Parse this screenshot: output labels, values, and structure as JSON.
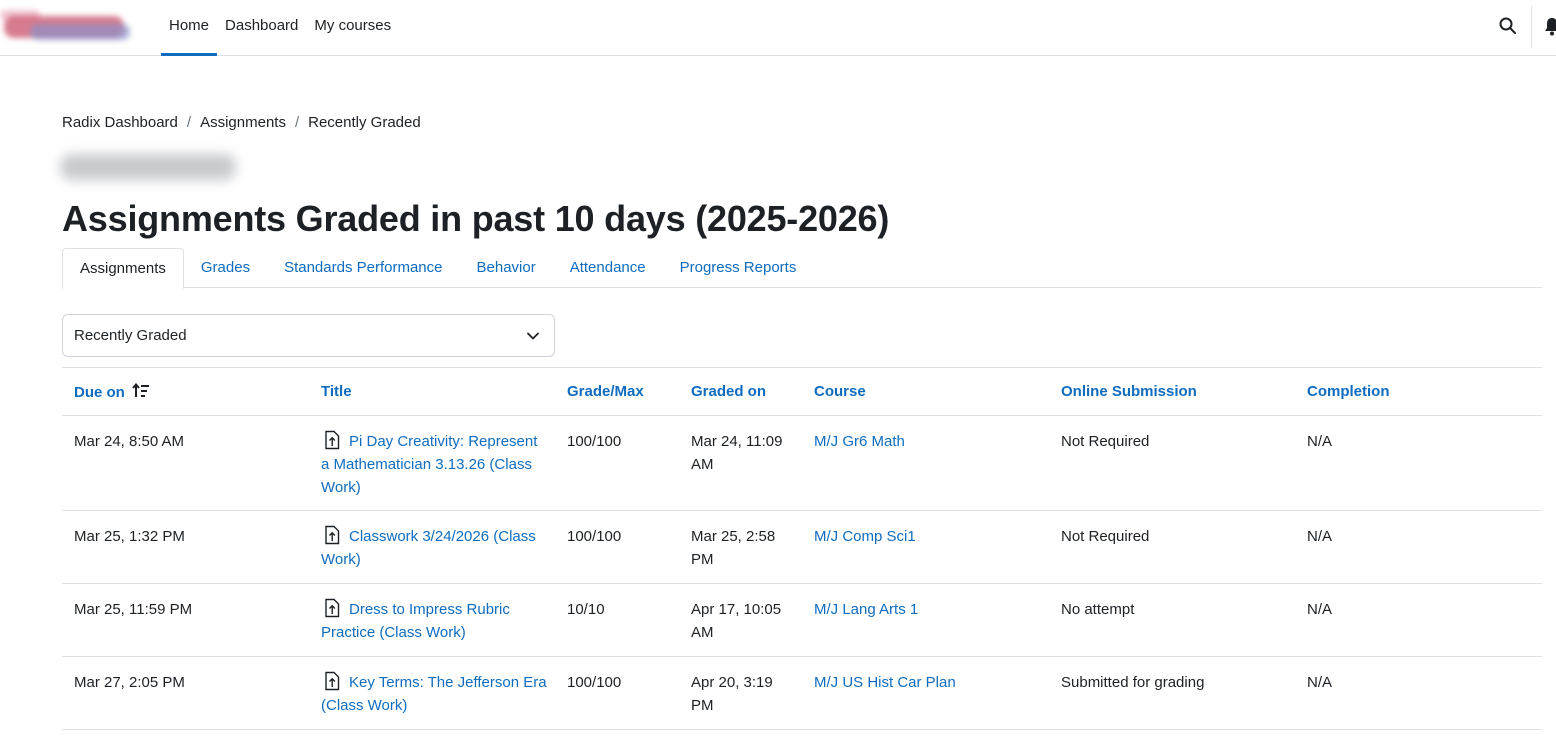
{
  "nav": {
    "links": [
      "Home",
      "Dashboard",
      "My courses"
    ]
  },
  "breadcrumb": [
    "Radix Dashboard",
    "Assignments",
    "Recently Graded"
  ],
  "page": {
    "title": "Assignments Graded in past 10 days (2025-2026)"
  },
  "tabs": [
    "Assignments",
    "Grades",
    "Standards Performance",
    "Behavior",
    "Attendance",
    "Progress Reports"
  ],
  "filter": {
    "selected": "Recently Graded"
  },
  "table": {
    "headers": {
      "due_on": "Due on",
      "title": "Title",
      "grade_max": "Grade/Max",
      "graded_on": "Graded on",
      "course": "Course",
      "online_submission": "Online Submission",
      "completion": "Completion"
    },
    "rows": [
      {
        "due_on": "Mar 24, 8:50 AM",
        "title": "Pi Day Creativity: Represent a Mathematician 3.13.26 (Class Work)",
        "grade_max": "100/100",
        "graded_on": "Mar 24, 11:09 AM",
        "course": "M/J Gr6 Math",
        "online_submission": "Not Required",
        "completion": "N/A"
      },
      {
        "due_on": "Mar 25, 1:32 PM",
        "title": "Classwork 3/24/2026 (Class Work)",
        "grade_max": "100/100",
        "graded_on": "Mar 25, 2:58 PM",
        "course": "M/J Comp Sci1",
        "online_submission": "Not Required",
        "completion": "N/A"
      },
      {
        "due_on": "Mar 25, 11:59 PM",
        "title": "Dress to Impress Rubric Practice (Class Work)",
        "grade_max": "10/10",
        "graded_on": "Apr 17, 10:05 AM",
        "course": "M/J Lang Arts 1",
        "online_submission": "No attempt",
        "completion": "N/A"
      },
      {
        "due_on": "Mar 27, 2:05 PM",
        "title": "Key Terms: The Jefferson Era (Class Work)",
        "grade_max": "100/100",
        "graded_on": "Apr 20, 3:19 PM",
        "course": "M/J US Hist Car Plan",
        "online_submission": "Submitted for grading",
        "completion": "N/A"
      }
    ]
  },
  "colors": {
    "link": "#0f6cbf",
    "text": "#1d2125",
    "border": "#dee2e6"
  }
}
